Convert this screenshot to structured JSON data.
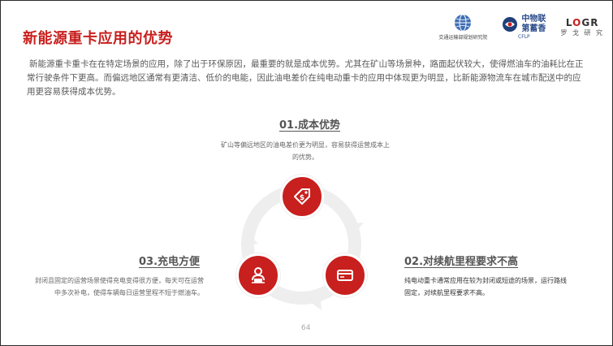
{
  "page": {
    "title": "新能源重卡应用的优势",
    "intro": "新能源重卡重卡在在特定场景的应用，除了出于环保原因，最重要的就是成本优势。尤其在矿山等场景种，路面起伏较大，使得燃油车的油耗比在正常行驶条件下更高。而偏远地区通常有更清洁、低价的电能，因此油电差价在纯电动重卡的应用中体现更为明显，比新能源物流车在城市配送中的应用更容易获得成本优势。",
    "page_number": "64"
  },
  "logos": {
    "mot": {
      "text": "交通运输部规划研究院",
      "icon": "globe-icon"
    },
    "cflp": {
      "cn": "中物联",
      "brand": "第蓄香",
      "abbr": "CFLP",
      "icon": "cflp-emblem-icon"
    },
    "logr": {
      "word_l": "L",
      "word_o": "O",
      "word_gr": "GR",
      "sub": "罗 戈 研 究"
    }
  },
  "sections": [
    {
      "title": "01.成本优势",
      "body": "矿山等偏远地区的油电差价更为明显，容易获得运营成本上的优势。",
      "icon": "price-tag-icon"
    },
    {
      "title": "02.对续航里程要求不高",
      "body": "纯电动重卡通常应用在较为封闭或短途的场景，运行路线固定，对续航里程要求不高。",
      "icon": "battery-card-icon"
    },
    {
      "title": "03.充电方便",
      "body": "封闭且固定的运营场景使得充电变得很方便，每天可在运营中多次补电，使得车辆每日运营里程不短于燃油车。",
      "icon": "person-laptop-icon"
    }
  ],
  "colors": {
    "accent": "#c8201e",
    "ring": "#eeeeee"
  }
}
